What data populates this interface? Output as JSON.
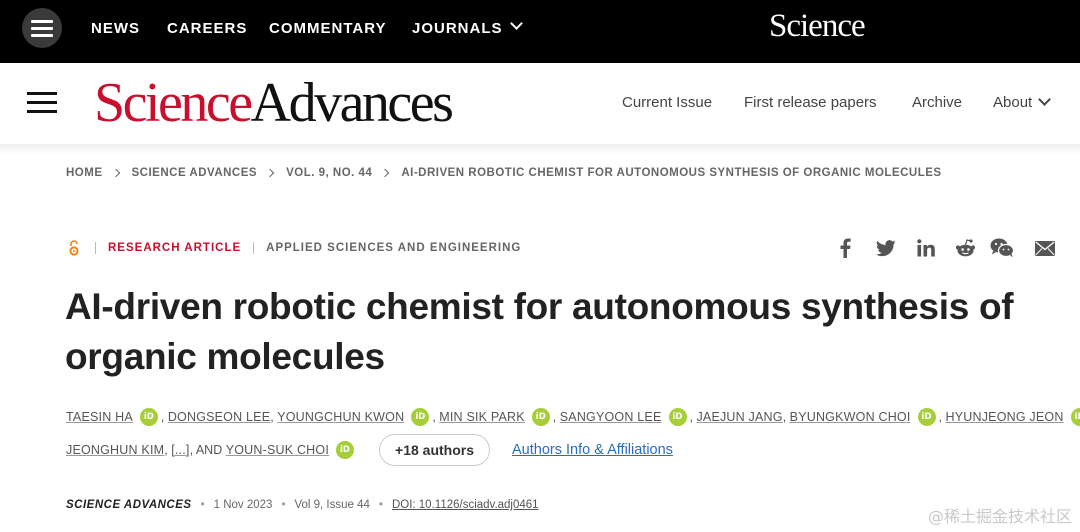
{
  "topbar": {
    "nav": [
      "NEWS",
      "CAREERS",
      "COMMENTARY",
      "JOURNALS"
    ],
    "logo": "Science"
  },
  "header": {
    "logo_red": "Science",
    "logo_black": "Advances",
    "nav": [
      "Current Issue",
      "First release papers",
      "Archive",
      "About"
    ]
  },
  "breadcrumb": [
    "HOME",
    "SCIENCE ADVANCES",
    "VOL. 9, NO. 44",
    "AI-DRIVEN ROBOTIC CHEMIST FOR AUTONOMOUS SYNTHESIS OF ORGANIC MOLECULES"
  ],
  "article": {
    "type": "RESEARCH ARTICLE",
    "section": "APPLIED SCIENCES AND ENGINEERING",
    "title": "AI-driven robotic chemist for autonomous synthesis of organic molecules"
  },
  "share_icons": [
    "facebook-icon",
    "twitter-icon",
    "linkedin-icon",
    "reddit-icon",
    "wechat-icon",
    "email-icon"
  ],
  "authors": {
    "line1": [
      "TAESIN HA",
      "DONGSEON LEE",
      "YOUNGCHUN KWON",
      "MIN SIK PARK",
      "SANGYOON LEE",
      "JAEJUN JANG",
      "BYUNGKWON CHOI",
      "HYUNJEONG JEON"
    ],
    "line2_a": "JEONGHUN KIM",
    "ellipsis": "[...]",
    "and": ", AND ",
    "last": "YOUN-SUK CHOI",
    "orcid_label": "iD",
    "more": "+18 authors",
    "affiliations": "Authors Info & Affiliations"
  },
  "citation": {
    "journal": "SCIENCE ADVANCES",
    "date": "1 Nov 2023",
    "issue": "Vol 9, Issue 44",
    "doi": "DOI: 10.1126/sciadv.adj0461"
  },
  "watermark": "@稀土掘金技术社区",
  "colors": {
    "brand_red": "#c8102e",
    "orcid_green": "#a6ce39",
    "link_blue": "#2a6ebb"
  }
}
